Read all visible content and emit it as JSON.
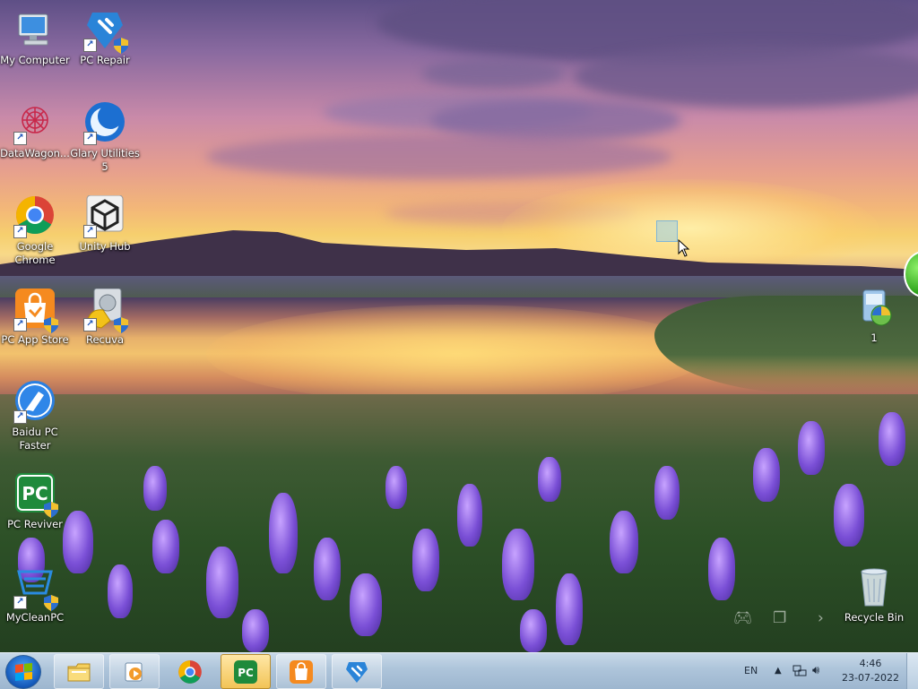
{
  "desktop": {
    "icons": [
      {
        "id": "my-computer",
        "label": "My Computer"
      },
      {
        "id": "pc-repair",
        "label": "PC Repair"
      },
      {
        "id": "datawagon",
        "label": "DataWagon..."
      },
      {
        "id": "glary",
        "label": "Glary Utilities 5"
      },
      {
        "id": "chrome",
        "label": "Google Chrome"
      },
      {
        "id": "unity-hub",
        "label": "Unity Hub"
      },
      {
        "id": "pc-app-store",
        "label": "PC App Store"
      },
      {
        "id": "recuva",
        "label": "Recuva"
      },
      {
        "id": "baidu",
        "label": "Baidu PC Faster"
      },
      {
        "id": "pc-reviver",
        "label": "PC Reviver"
      },
      {
        "id": "mycleanpc",
        "label": "MyCleanPC"
      },
      {
        "id": "file-1",
        "label": "1"
      },
      {
        "id": "recycle-bin",
        "label": "Recycle Bin"
      }
    ]
  },
  "taskbar": {
    "buttons": [
      {
        "id": "explorer",
        "icon": "folder-icon"
      },
      {
        "id": "media-player",
        "icon": "media-player-icon"
      },
      {
        "id": "chrome",
        "icon": "chrome-icon"
      },
      {
        "id": "pc-reviver",
        "icon": "pc-reviver-icon"
      },
      {
        "id": "pc-app-store",
        "icon": "shopping-bag-icon"
      },
      {
        "id": "shield-app",
        "icon": "shield-icon"
      }
    ],
    "tray": {
      "language": "EN",
      "time": "4:46",
      "date": "23-07-2022"
    }
  },
  "colors": {
    "taskbar": "#adc4da",
    "active_button": "#f2c457",
    "icon_label": "#ffffff"
  }
}
